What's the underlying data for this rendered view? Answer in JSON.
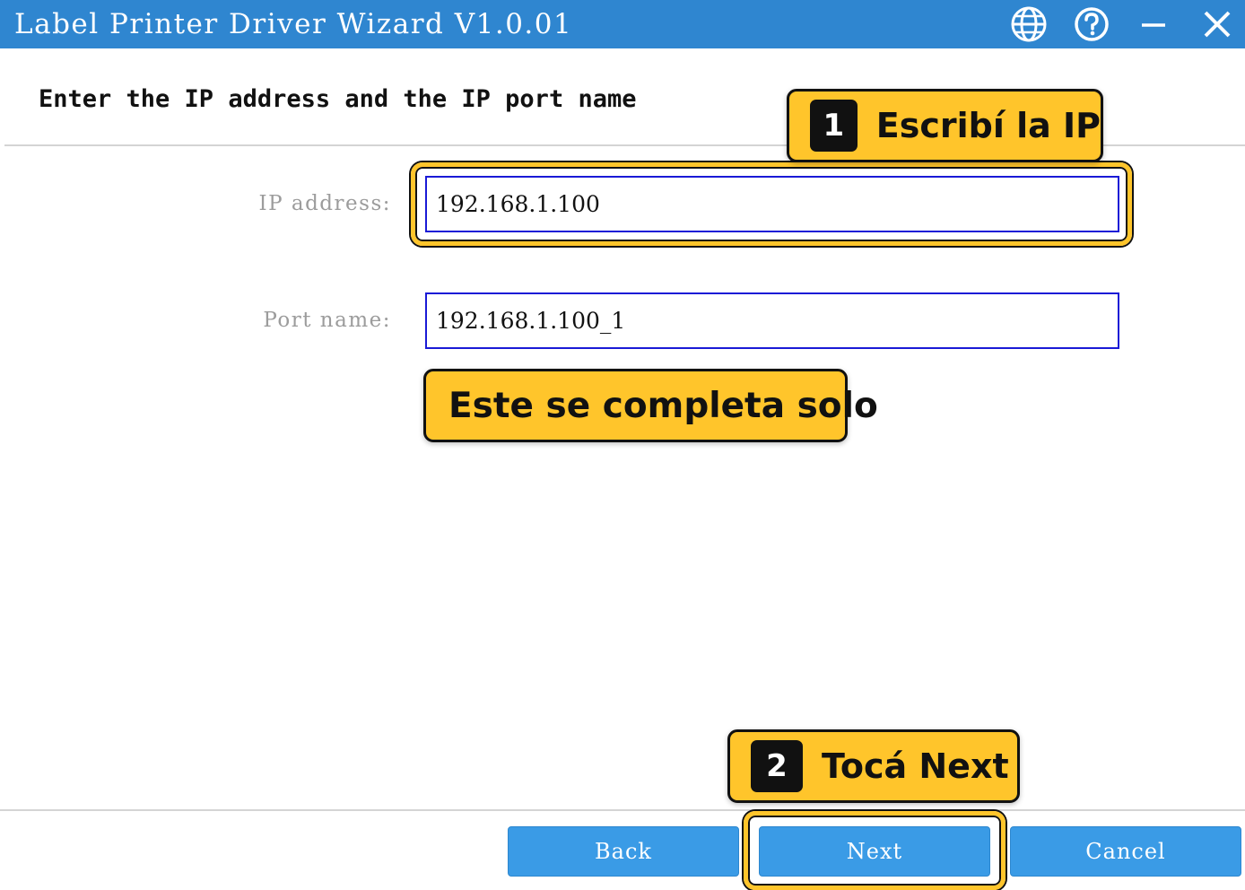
{
  "window": {
    "title": "Label Printer Driver Wizard  V1.0.01",
    "controls": [
      "globe-icon",
      "help-icon",
      "minimize-icon",
      "close-icon"
    ]
  },
  "page": {
    "heading": "Enter the IP address and the IP port name"
  },
  "form": {
    "ip_label": "IP address:",
    "ip_value": "192.168.1.100",
    "port_label": "Port name:",
    "port_value": "192.168.1.100_1"
  },
  "annotations": {
    "step1_number": "1",
    "step1_text": "Escribí la IP",
    "autofill_note": "Este se completa solo",
    "step2_number": "2",
    "step2_text": "Tocá Next"
  },
  "buttons": {
    "back": "Back",
    "next": "Next",
    "cancel": "Cancel"
  },
  "colors": {
    "titlebar": "#2f86d0",
    "button": "#3a9be6",
    "input_border": "#1a1ad6",
    "callout": "#ffc52b"
  }
}
